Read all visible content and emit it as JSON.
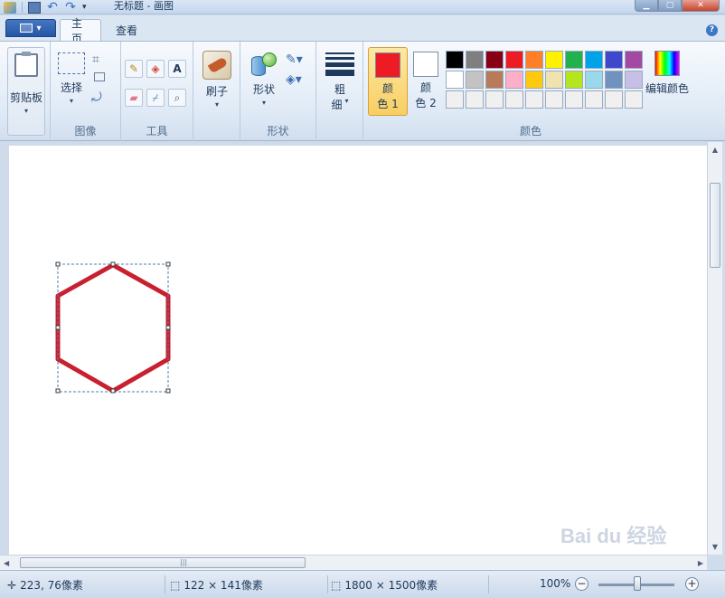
{
  "window": {
    "title": "无标题 - 画图",
    "controls": [
      "minimize",
      "maximize",
      "close"
    ]
  },
  "quick_access": {
    "icons": [
      "app-icon",
      "save-icon",
      "undo-icon",
      "redo-icon",
      "customize-icon"
    ]
  },
  "tabs": {
    "home": "主页",
    "view": "查看"
  },
  "ribbon": {
    "clipboard": {
      "label": "剪贴板"
    },
    "image": {
      "select_label": "选择",
      "group_label": "图像"
    },
    "tools": {
      "group_label": "工具",
      "text_glyph": "A"
    },
    "brushes": {
      "label": "刷子"
    },
    "shapes": {
      "label": "形状",
      "group_label": "形状"
    },
    "size": {
      "label_line1": "粗",
      "label_line2": "细"
    },
    "colors": {
      "color1_line1": "颜",
      "color1_line2": "色 1",
      "color2_line1": "颜",
      "color2_line2": "色 2",
      "color1_value": "#ed1c24",
      "color2_value": "#ffffff",
      "edit_label": "编辑颜色",
      "group_label": "颜色",
      "palette_row1": [
        "#000000",
        "#7f7f7f",
        "#880015",
        "#ed1c24",
        "#ff7f27",
        "#fff200",
        "#22b14c",
        "#00a2e8",
        "#3f48cc",
        "#a349a4"
      ],
      "palette_row2": [
        "#ffffff",
        "#c3c3c3",
        "#b97a57",
        "#ffaec9",
        "#ffc90e",
        "#efe4b0",
        "#b5e61d",
        "#99d9ea",
        "#7092be",
        "#c8bfe7"
      ],
      "palette_row3": [
        "#f0f0f0",
        "#f0f0f0",
        "#f0f0f0",
        "#f0f0f0",
        "#f0f0f0",
        "#f0f0f0",
        "#f0f0f0",
        "#f0f0f0",
        "#f0f0f0",
        "#f0f0f0"
      ]
    }
  },
  "canvas": {
    "shape": "hexagon",
    "stroke_color": "#c8202e"
  },
  "status": {
    "cursor_pos": "223, 76像素",
    "selection_size": "122 × 141像素",
    "image_size": "1800 × 1500像素",
    "zoom": "100%"
  },
  "watermark": {
    "text": "Bai du 经验"
  }
}
